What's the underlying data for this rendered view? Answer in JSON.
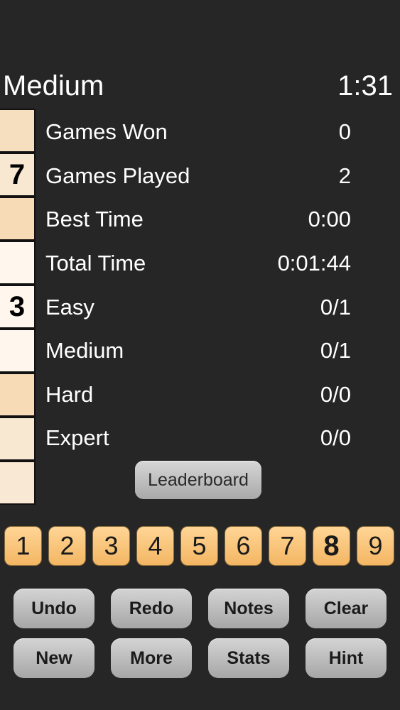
{
  "header": {
    "difficulty": "Medium",
    "timer": "1:31"
  },
  "grid": {
    "cells": [
      "",
      "7",
      "",
      "",
      "3",
      "",
      "",
      "",
      ""
    ],
    "colors": [
      "#f6dfbf",
      "#f8e8d2",
      "#f7dbb7",
      "#fff7ee",
      "#fff7ee",
      "#fff7ee",
      "#f7dbb7",
      "#f8e8d2",
      "#f9e8d3"
    ]
  },
  "stats": [
    {
      "label": "Games Won",
      "value": "0"
    },
    {
      "label": "Games Played",
      "value": "2"
    },
    {
      "label": "Best Time",
      "value": "0:00"
    },
    {
      "label": "Total Time",
      "value": "0:01:44"
    },
    {
      "label": "Easy",
      "value": "0/1"
    },
    {
      "label": "Medium",
      "value": "0/1"
    },
    {
      "label": "Hard",
      "value": "0/0"
    },
    {
      "label": "Expert",
      "value": "0/0"
    }
  ],
  "leaderboard_label": "Leaderboard",
  "digits": [
    "1",
    "2",
    "3",
    "4",
    "5",
    "6",
    "7",
    "8",
    "9"
  ],
  "selected_digit": "8",
  "buttons": {
    "undo": "Undo",
    "redo": "Redo",
    "notes": "Notes",
    "clear": "Clear",
    "new": "New",
    "more": "More",
    "stats": "Stats",
    "hint": "Hint"
  },
  "colors": {
    "background": "#262626",
    "digit_key": "#f9c57a",
    "button": "#bdbdbd"
  }
}
